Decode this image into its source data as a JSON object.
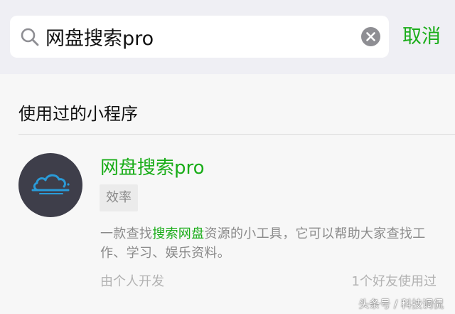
{
  "search": {
    "query": "网盘搜索pro",
    "cancel_label": "取消"
  },
  "section": {
    "title": "使用过的小程序"
  },
  "result": {
    "name": "网盘搜索pro",
    "category": "效率",
    "description_prefix": "一款查找",
    "description_highlight": "搜索网盘",
    "description_suffix": "资源的小工具，它可以帮助大家查找工作、学习、娱乐资料。",
    "developer": "由个人开发",
    "friends_used": "1个好友使用过"
  },
  "watermark": "头条号 / 科技调侃",
  "colors": {
    "accent": "#1aad19",
    "avatar_bg": "#3e3e4a",
    "cloud": "#2a9bd8",
    "page_bg": "#efeff4",
    "panel_bg": "#f7f7f7"
  },
  "icons": {
    "search": "search-icon",
    "clear": "clear-icon",
    "app_logo": "cloud-icon"
  }
}
